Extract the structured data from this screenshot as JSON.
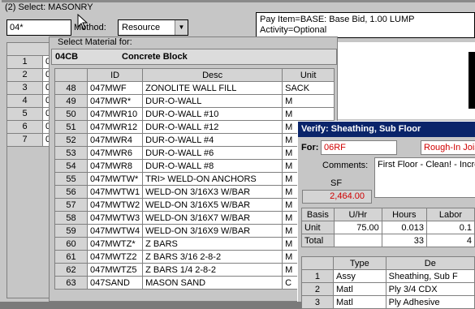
{
  "window": {
    "title": "(2) Select: MASONRY"
  },
  "search": {
    "value": "04*"
  },
  "method": {
    "label": "Method:",
    "selected": "Resource"
  },
  "pay_item": {
    "line1": "Pay Item=BASE: Base Bid, 1.00 LUMP",
    "line2": "Activity=Optional"
  },
  "left_grid": {
    "rows": [
      {
        "num": "1",
        "val": "0"
      },
      {
        "num": "2",
        "val": "0"
      },
      {
        "num": "3",
        "val": "0"
      },
      {
        "num": "4",
        "val": "0"
      },
      {
        "num": "5",
        "val": "0"
      },
      {
        "num": "6",
        "val": "0"
      },
      {
        "num": "7",
        "val": "0"
      }
    ]
  },
  "material": {
    "legend": "Select Material for:",
    "code": "04CB",
    "name": "Concrete Block",
    "columns": [
      "ID",
      "Desc",
      "Unit"
    ],
    "rows": [
      {
        "rn": "48",
        "id": "047MWF",
        "desc": "ZONOLITE WALL FILL",
        "unit": "SACK"
      },
      {
        "rn": "49",
        "id": "047MWR*",
        "desc": "DUR-O-WALL",
        "unit": "M"
      },
      {
        "rn": "50",
        "id": "047MWR10",
        "desc": "DUR-O-WALL #10",
        "unit": "M"
      },
      {
        "rn": "51",
        "id": "047MWR12",
        "desc": "DUR-O-WALL #12",
        "unit": "M"
      },
      {
        "rn": "52",
        "id": "047MWR4",
        "desc": "DUR-O-WALL #4",
        "unit": "M"
      },
      {
        "rn": "53",
        "id": "047MWR6",
        "desc": "DUR-O-WALL #6",
        "unit": "M"
      },
      {
        "rn": "54",
        "id": "047MWR8",
        "desc": "DUR-O-WALL #8",
        "unit": "M"
      },
      {
        "rn": "55",
        "id": "047MWTW*",
        "desc": "TRI> WELD-ON ANCHORS",
        "unit": "M"
      },
      {
        "rn": "56",
        "id": "047MWTW1",
        "desc": "WELD-ON 3/16X3 W/BAR",
        "unit": "M"
      },
      {
        "rn": "57",
        "id": "047MWTW2",
        "desc": "WELD-ON 3/16X5 W/BAR",
        "unit": "M"
      },
      {
        "rn": "58",
        "id": "047MWTW3",
        "desc": "WELD-ON 3/16X7 W/BAR",
        "unit": "M"
      },
      {
        "rn": "59",
        "id": "047MWTW4",
        "desc": "WELD-ON 3/16X9 W/BAR",
        "unit": "M"
      },
      {
        "rn": "60",
        "id": "047MWTZ*",
        "desc": "Z BARS",
        "unit": "M"
      },
      {
        "rn": "61",
        "id": "047MWTZ2",
        "desc": "Z BARS 3/16 2-8-2",
        "unit": "M"
      },
      {
        "rn": "62",
        "id": "047MWTZ5",
        "desc": "Z BARS 1/4 2-8-2",
        "unit": "M"
      },
      {
        "rn": "63",
        "id": "047SAND",
        "desc": "MASON SAND",
        "unit": "C"
      }
    ]
  },
  "verify": {
    "title": "Verify: Sheathing, Sub Floor",
    "for_label": "For:",
    "for_value": "06RF",
    "rough_in": "Rough-In Joists",
    "comments_label": "Comments:",
    "comments_value": "First Floor - Clean! - Increase",
    "sf_label": "SF",
    "sf_value": "2,464.00",
    "labor_table": {
      "headers": [
        "Basis",
        "U/Hr",
        "Hours",
        "Labor"
      ],
      "rows": [
        {
          "label": "Unit",
          "uhr": "75.00",
          "hours": "0.013",
          "labor": "0.1"
        },
        {
          "label": "Total",
          "uhr": "",
          "hours": "33",
          "labor": "4"
        }
      ]
    },
    "assy_table": {
      "headers": [
        "",
        "Type",
        "De"
      ],
      "rows": [
        {
          "rn": "1",
          "type": "Assy",
          "desc": "Sheathing, Sub F"
        },
        {
          "rn": "2",
          "type": "Matl",
          "desc": "Ply 3/4 CDX"
        },
        {
          "rn": "3",
          "type": "Matl",
          "desc": "Ply Adhesive"
        }
      ]
    }
  }
}
